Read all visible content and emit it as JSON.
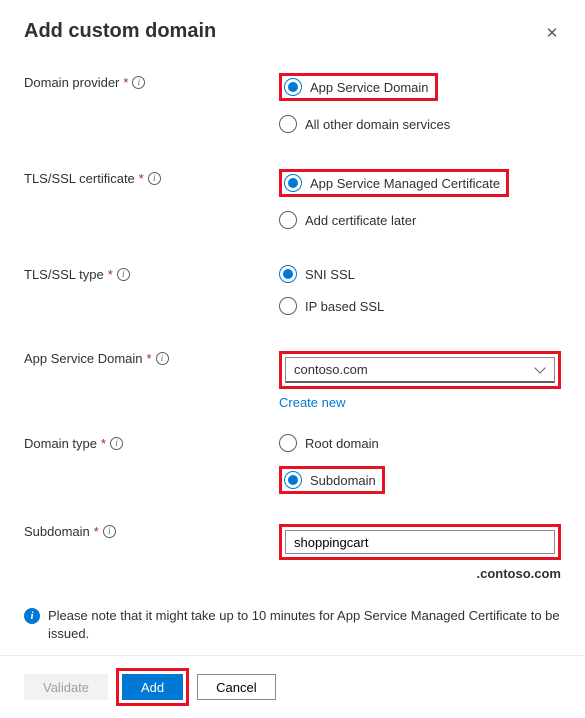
{
  "title": "Add custom domain",
  "fields": {
    "domain_provider": {
      "label": "Domain provider",
      "options": [
        "App Service Domain",
        "All other domain services"
      ],
      "selected": 0
    },
    "tls_certificate": {
      "label": "TLS/SSL certificate",
      "options": [
        "App Service Managed Certificate",
        "Add certificate later"
      ],
      "selected": 0
    },
    "tls_type": {
      "label": "TLS/SSL type",
      "options": [
        "SNI SSL",
        "IP based SSL"
      ],
      "selected": 0
    },
    "app_service_domain": {
      "label": "App Service Domain",
      "value": "contoso.com",
      "create_link": "Create new"
    },
    "domain_type": {
      "label": "Domain type",
      "options": [
        "Root domain",
        "Subdomain"
      ],
      "selected": 1
    },
    "subdomain": {
      "label": "Subdomain",
      "value": "shoppingcart",
      "suffix": ".contoso.com"
    }
  },
  "info": "Please note that it might take up to 10 minutes for App Service Managed Certificate to be issued.",
  "buttons": {
    "validate": "Validate",
    "add": "Add",
    "cancel": "Cancel"
  }
}
